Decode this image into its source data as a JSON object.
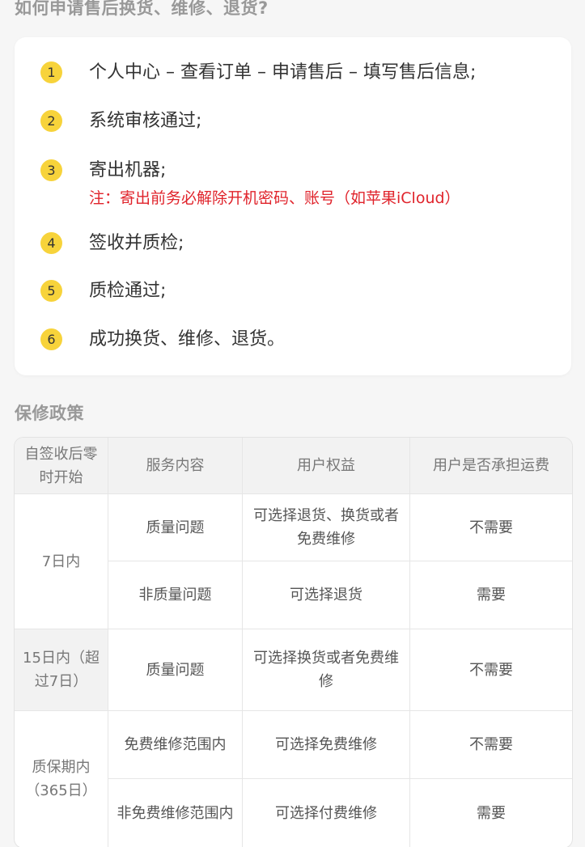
{
  "section1": {
    "title": "如何申请售后换货、维修、退货?",
    "steps": [
      {
        "num": "1",
        "text": "个人中心 – 查看订单 – 申请售后 – 填写售后信息;"
      },
      {
        "num": "2",
        "text": "系统审核通过;"
      },
      {
        "num": "3",
        "text": "寄出机器;",
        "note": "注：寄出前务必解除开机密码、账号（如苹果iCloud）"
      },
      {
        "num": "4",
        "text": "签收并质检;"
      },
      {
        "num": "5",
        "text": "质检通过;"
      },
      {
        "num": "6",
        "text": "成功换货、维修、退货。"
      }
    ]
  },
  "section2": {
    "title": "保修政策",
    "headers": [
      "自签收后零时开始",
      "服务内容",
      "用户权益",
      "用户是否承担运费"
    ],
    "groups": [
      {
        "period": "7日内",
        "rows": [
          {
            "service": "质量问题",
            "rights": "可选择退货、换货或者免费维修",
            "shipping": "不需要"
          },
          {
            "service": "非质量问题",
            "rights": "可选择退货",
            "shipping": "需要"
          }
        ]
      },
      {
        "period": "15日内（超过7日）",
        "rows": [
          {
            "service": "质量问题",
            "rights": "可选择换货或者免费维修",
            "shipping": "不需要"
          }
        ]
      },
      {
        "period": "质保期内（365日）",
        "rows": [
          {
            "service": "免费维修范围内",
            "rights": "可选择免费维修",
            "shipping": "不需要"
          },
          {
            "service": "非免费维修范围内",
            "rights": "可选择付费维修",
            "shipping": "需要"
          }
        ]
      }
    ],
    "accent_color": "#f7d33b",
    "note_color": "#e0232b"
  }
}
